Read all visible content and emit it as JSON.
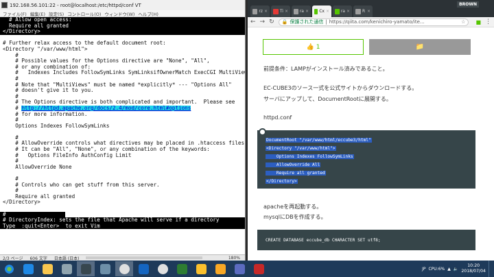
{
  "terminal": {
    "title": "192.168.56.101:22 - root@localhost:/etc/httpd/conf VT",
    "menu": [
      "ファイル(F)",
      "編集(E)",
      "設定(S)",
      "コントロール(O)",
      "ウィンドウ(W)",
      "ヘルプ(H)"
    ],
    "top_lines": [
      "  # Allow open access:",
      "  Require all granted",
      "</Directory>"
    ],
    "lines": [
      "",
      "# Further relax access to the default document root:",
      "<Directory \"/var/www/html\">",
      "    #",
      "    # Possible values for the Options directive are \"None\", \"All\",",
      "    # or any combination of:",
      "    #   Indexes Includes FollowSymLinks SymLinksifOwnerMatch ExecCGI MultiViews",
      "    #",
      "    # Note that \"MultiViews\" must be named *explicitly* --- \"Options All\"",
      "    # doesn't give it to you.",
      "    #",
      "    # The Options directive is both complicated and important.  Please see",
      "    # ",
      "    # for more information.",
      "    #",
      "    Options Indexes FollowSymLinks",
      "",
      "    #",
      "    # AllowOverride controls what directives may be placed in .htaccess files.",
      "    # It can be \"All\", \"None\", or any combination of the keywords:",
      "    #   Options FileInfo AuthConfig Limit",
      "    #",
      "    AllowOverride None",
      "",
      "    #",
      "    # Controls who can get stuff from this server.",
      "    #",
      "    Require all granted",
      "</Directory>",
      ""
    ],
    "link": "http://httpd.apache.org/docs/2.4/mod/core.html#options",
    "bottom_lines": [
      "#",
      "# DirectoryIndex: sets the file that Apache will serve if a directory",
      "Type  :quit<Enter>  to exit Vim"
    ],
    "status_left": "2/3 ページ",
    "status_words": "606 文字",
    "status_lang": "日本語 (日本)",
    "zoom": "180%"
  },
  "browser": {
    "user": "BROWN",
    "tabs": [
      {
        "label": "rz",
        "color": "#9e9e9e"
      },
      {
        "label": "Ti",
        "color": "#e53935"
      },
      {
        "label": "ra",
        "color": "#9e9e9e"
      },
      {
        "label": "Cx",
        "color": "#55c500"
      },
      {
        "label": "ra",
        "color": "#55c500"
      },
      {
        "label": "R",
        "color": "#9e9e9e"
      }
    ],
    "security": "保護された通信",
    "url": "https://qiita.com/kenichiro-yamato/ite...",
    "like_count": "1",
    "p1": "前提条件：LAMPがインストール済みであること。",
    "p2a": "EC-CUBE3のソース一式を公式サイトからダウンロードする。",
    "p2b": "サーバにアップして、DocumentRootに展開する。",
    "p3": "httpd.conf",
    "code1": [
      "DocumentRoot \"/var/www/html/eccube3/html\"",
      "<Directory \"/var/www/html\">",
      "    Options Indexes FollowSymLinks",
      "    AllowOverride All",
      "    Require all granted",
      "</Directory>"
    ],
    "p4": "apacheを再起動する。",
    "p5": "mysqlにDBを作成する。",
    "code2": "CREATE DATABASE eccube_db CHARACTER SET utf8;"
  },
  "taskbar": {
    "apps": [
      {
        "name": "ie",
        "color": "#1e88e5"
      },
      {
        "name": "explorer",
        "color": "#f9c74f"
      },
      {
        "name": "mail",
        "color": "#90a4ae"
      },
      {
        "name": "terminal",
        "color": "#37474f"
      },
      {
        "name": "vm",
        "color": "#6d8fa8"
      },
      {
        "name": "chrome",
        "color": "#e0e0e0"
      },
      {
        "name": "word",
        "color": "#1565c0"
      },
      {
        "name": "chrome2",
        "color": "#e0e0e0"
      },
      {
        "name": "excel",
        "color": "#2e7d32"
      },
      {
        "name": "notes",
        "color": "#fbc02d"
      },
      {
        "name": "app-t",
        "color": "#f9a825"
      },
      {
        "name": "app-cube",
        "color": "#5c6bc0"
      },
      {
        "name": "app-red",
        "color": "#c62828"
      }
    ],
    "tray_lang": "JP",
    "net_speed": "CPU:6%",
    "time": "10:20",
    "date": "2018/07/04"
  }
}
